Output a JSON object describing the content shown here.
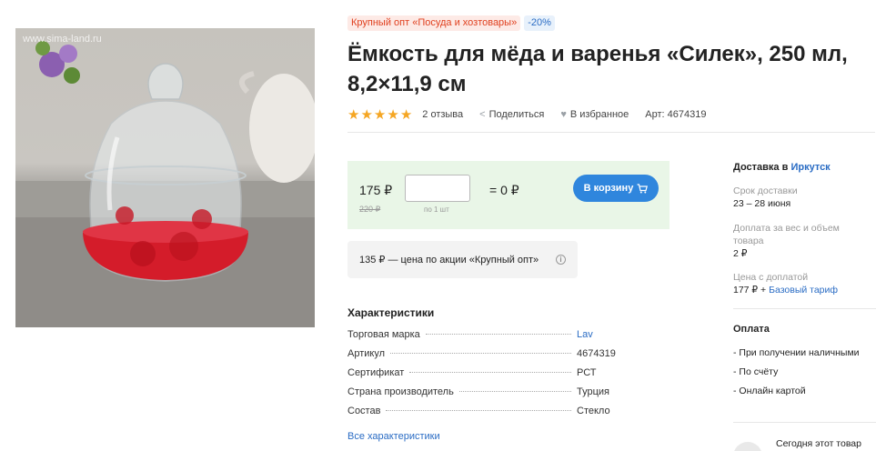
{
  "product": {
    "image_watermark": "www.sima-land.ru",
    "badge_promo": "Крупный опт «Посуда и хозтовары»",
    "badge_discount": "-20%",
    "title": "Ёмкость для мёда и варенья «Силек», 250 мл, 8,2×11,9 см",
    "rating": 5,
    "reviews": "2 отзыва",
    "share": "Поделиться",
    "favorite": "В избранное",
    "article": "Арт: 4674319"
  },
  "buy": {
    "price": "175 ₽",
    "old_price": "220 ₽",
    "quantity": "",
    "per_unit": "по 1 шт",
    "total": "= 0 ₽",
    "cart_label": "В корзину"
  },
  "promo_note": "135 ₽ — цена по акции «Крупный опт»",
  "specs": {
    "title": "Характеристики",
    "rows": [
      {
        "name": "Торговая марка",
        "value": "Lav"
      },
      {
        "name": "Артикул",
        "value": "4674319"
      },
      {
        "name": "Сертификат",
        "value": "РСТ"
      },
      {
        "name": "Страна производитель",
        "value": "Турция"
      },
      {
        "name": "Состав",
        "value": "Стекло"
      }
    ],
    "all_link": "Все характеристики"
  },
  "delivery": {
    "title_prefix": "Доставка в",
    "city": "Иркутск",
    "term_label": "Срок доставки",
    "term_value": "23 – 28 июня",
    "surcharge_label": "Доплата за вес и объем товара",
    "surcharge_value": "2 ₽",
    "price_label": "Цена с доплатой",
    "price_value": "177 ₽ +",
    "tariff_link": "Базовый тариф"
  },
  "payment": {
    "title": "Оплата",
    "methods": [
      "- При получении наличными",
      "- По счёту",
      "- Онлайн картой"
    ]
  },
  "today_note": "Сегодня этот товар",
  "colors": {
    "accent": "#2f86dd",
    "star": "#f5a623",
    "buybox": "#e9f6e7",
    "promo": "#e0401f",
    "link": "#2a6cc4"
  }
}
